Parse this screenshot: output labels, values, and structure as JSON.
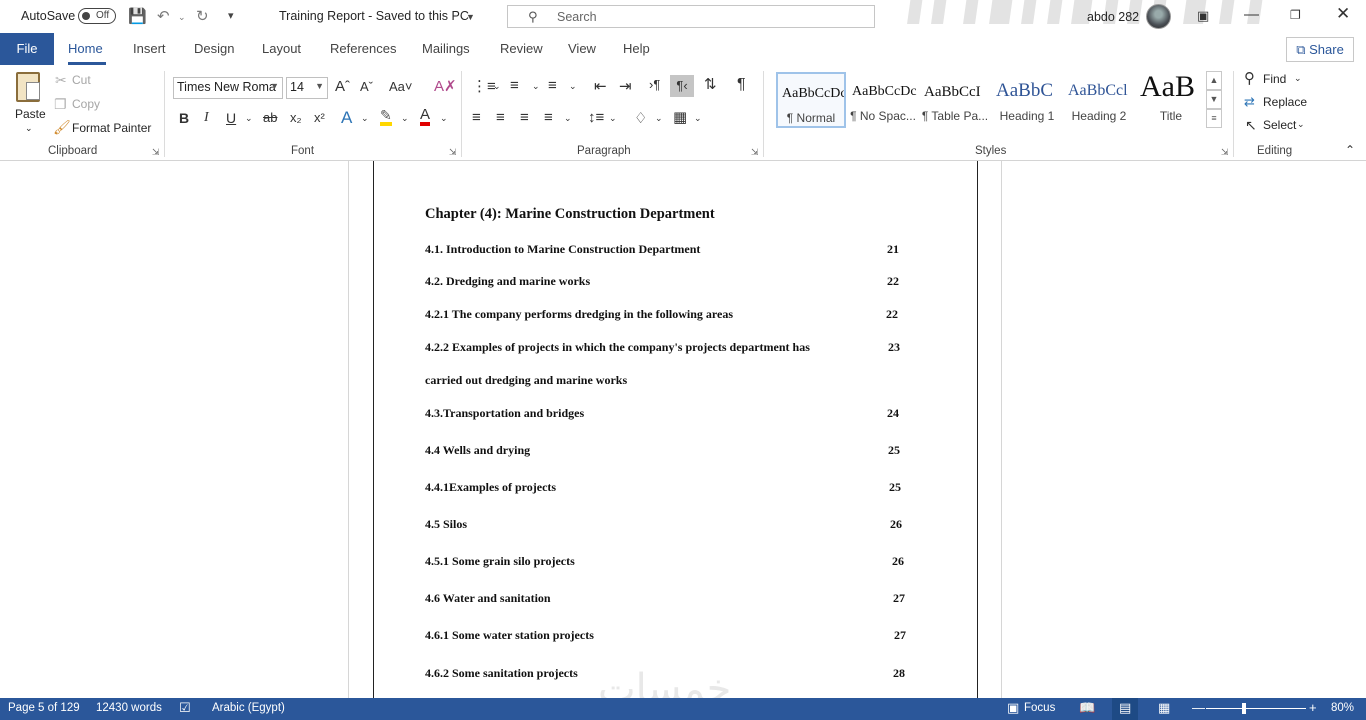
{
  "titlebar": {
    "autosave_label": "AutoSave",
    "autosave_state": "Off",
    "doc_title": "Training Report  -  Saved to this PC",
    "search_placeholder": "Search",
    "user_name": "abdo 282"
  },
  "tabs": {
    "file": "File",
    "items": [
      "Home",
      "Insert",
      "Design",
      "Layout",
      "References",
      "Mailings",
      "Review",
      "View",
      "Help"
    ],
    "active": "Home",
    "share": "Share"
  },
  "clipboard": {
    "paste": "Paste",
    "cut": "Cut",
    "copy": "Copy",
    "format_painter": "Format Painter",
    "group_label": "Clipboard"
  },
  "font": {
    "font_name": "Times New Roma",
    "font_size": "14",
    "group_label": "Font"
  },
  "paragraph": {
    "group_label": "Paragraph"
  },
  "styles": {
    "group_label": "Styles",
    "items": [
      {
        "preview": "AaBbCcDc",
        "name": "¶ Normal"
      },
      {
        "preview": "AaBbCcDc",
        "name": "¶ No Spac..."
      },
      {
        "preview": "AaBbCcI",
        "name": "¶ Table Pa..."
      },
      {
        "preview": "AaBbC",
        "name": "Heading 1"
      },
      {
        "preview": "AaBbCcl",
        "name": "Heading 2"
      },
      {
        "preview": "AaB",
        "name": "Title"
      }
    ]
  },
  "editing": {
    "find": "Find",
    "replace": "Replace",
    "select": "Select",
    "group_label": "Editing"
  },
  "document": {
    "chapter_heading": "Chapter (4): Marine Construction Department",
    "toc": [
      {
        "text": "4.1. Introduction to Marine Construction Department",
        "page": "21"
      },
      {
        "text": "4.2. Dredging and marine works",
        "page": "22"
      },
      {
        "text": "4.2.1 The company performs dredging in the following areas",
        "page": "22"
      },
      {
        "text": "4.2.2 Examples of projects in which the company's projects department has",
        "page": "23"
      },
      {
        "text": " carried out dredging and marine works",
        "page": ""
      },
      {
        "text": "4.3.Transportation and bridges",
        "page": "24"
      },
      {
        "text": "4.4 Wells and drying",
        "page": "25"
      },
      {
        "text": "4.4.1Examples of projects",
        "page": "25"
      },
      {
        "text": "4.5 Silos",
        "page": "26"
      },
      {
        "text": "4.5.1 Some grain silo projects",
        "page": "26"
      },
      {
        "text": "4.6 Water and sanitation",
        "page": "27"
      },
      {
        "text": "4.6.1 Some water station projects",
        "page": "27"
      },
      {
        "text": "4.6.2 Some sanitation projects",
        "page": "28"
      }
    ],
    "watermark": "خمسات"
  },
  "statusbar": {
    "page": "Page 5 of 129",
    "words": "12430 words",
    "language": "Arabic (Egypt)",
    "focus": "Focus",
    "zoom": "80%"
  }
}
